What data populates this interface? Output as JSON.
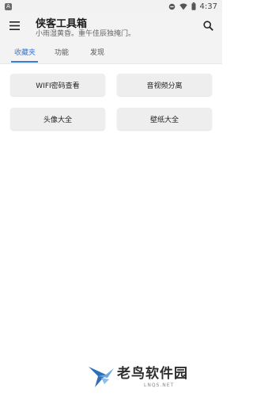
{
  "status_bar": {
    "app_indicator": "A",
    "time": "4:37"
  },
  "app_bar": {
    "title": "侠客工具箱",
    "subtitle": "小雨湿黄昏。重午佳辰独掩门。"
  },
  "tabs": [
    {
      "label": "收藏夹",
      "active": true
    },
    {
      "label": "功能",
      "active": false
    },
    {
      "label": "发现",
      "active": false
    }
  ],
  "buttons": [
    {
      "label": "WIFI密码查看"
    },
    {
      "label": "音视频分离"
    },
    {
      "label": "头像大全"
    },
    {
      "label": "壁纸大全"
    }
  ],
  "watermark": {
    "text": "老鸟软件园",
    "sub": "LNQS.NET"
  },
  "colors": {
    "accent": "#3a7bd5",
    "background": "#ffffff",
    "bar": "#f3f3f3"
  }
}
